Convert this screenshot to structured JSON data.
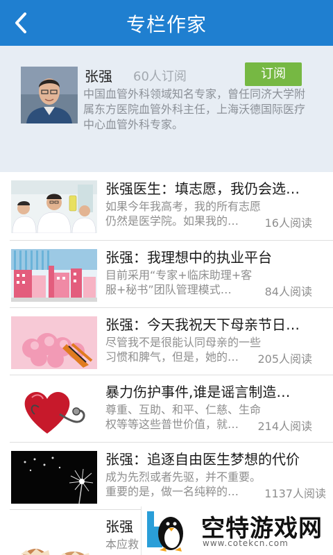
{
  "header": {
    "title": "专栏作家"
  },
  "author": {
    "name": "张强",
    "subscribers": "60人订阅",
    "subscribe_label": "订阅",
    "description": "中国血管外科领域知名专家，曾任同济大学附属东方医院血管外科主任，上海沃德国际医疗中心血管外科专家。"
  },
  "articles": [
    {
      "title": "张强医生：填志愿，我仍会选…",
      "summary": "如果今年我高考，我的所有志愿仍然是医学院。如果我的…",
      "reads": "16人阅读"
    },
    {
      "title": "张强：我理想中的执业平台",
      "summary": "目前采用“专家+临床助理+客服+秘书”团队管理模式…",
      "reads": "84人阅读"
    },
    {
      "title": "张强：今天我祝天下母亲节日…",
      "summary": "尽管我不是很能认同母亲的一些习惯和脾气，但是，她的…",
      "reads": "205人阅读"
    },
    {
      "title": "暴力伤护事件,谁是谣言制造…",
      "summary": "尊重、互助、和平、仁慈、生命权等等这些普世价值，就…",
      "reads": "214人阅读"
    },
    {
      "title": "张强：追逐自由医生梦想的代价",
      "summary": "成为先烈或者先驱，并不重要。重要的是，做一名纯粹的…",
      "reads": "1137人阅读"
    },
    {
      "title": "张强",
      "summary": "本应救",
      "reads": ""
    }
  ],
  "watermark": {
    "title": "空特游戏网",
    "url": "www.cotekcn.com"
  }
}
